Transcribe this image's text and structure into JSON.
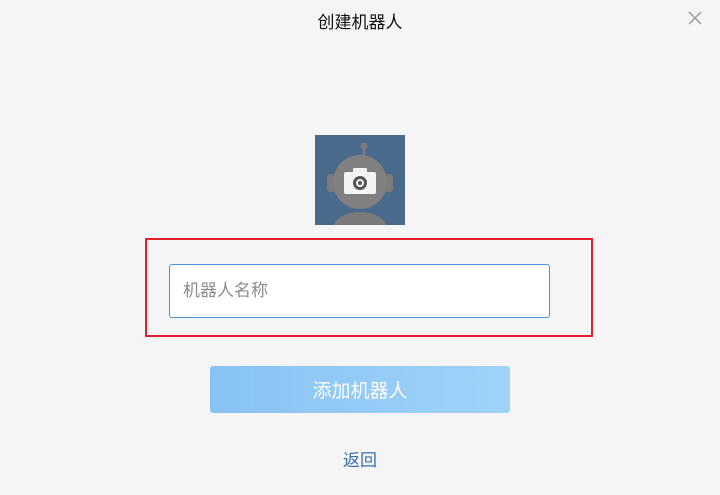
{
  "dialog": {
    "title": "创建机器人",
    "close_icon": "close-icon"
  },
  "avatar": {
    "icon": "robot-avatar-camera-icon",
    "bg_color": "#4a6a8c"
  },
  "form": {
    "name_placeholder": "机器人名称",
    "name_value": "",
    "submit_label": "添加机器人",
    "back_label": "返回"
  },
  "colors": {
    "highlight_border": "#e1222a",
    "input_border": "#4d92dd",
    "button_gradient_start": "#6db6f5",
    "button_gradient_end": "#8ccbfa",
    "link": "#3a6ea8"
  }
}
